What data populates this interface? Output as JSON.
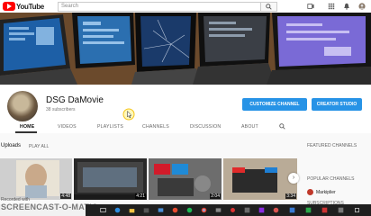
{
  "topbar": {
    "logo_text": "YouTube",
    "search_placeholder": "Search",
    "icons": [
      "search-icon",
      "upload-icon",
      "apps-icon",
      "notifications-icon",
      "account-icon"
    ]
  },
  "channel": {
    "name": "DSG DaMovie",
    "subscribers": "38 subscribers",
    "customize_label": "CUSTOMIZE CHANNEL",
    "studio_label": "CREATOR STUDIO"
  },
  "tabs": [
    {
      "label": "HOME",
      "active": true
    },
    {
      "label": "VIDEOS",
      "active": false
    },
    {
      "label": "PLAYLISTS",
      "active": false
    },
    {
      "label": "CHANNELS",
      "active": false
    },
    {
      "label": "DISCUSSION",
      "active": false
    },
    {
      "label": "ABOUT",
      "active": false
    }
  ],
  "uploads": {
    "title": "Uploads",
    "play_all": "PLAY ALL",
    "videos": [
      {
        "duration": "4:48"
      },
      {
        "duration": "4:21"
      },
      {
        "duration": "2:04"
      },
      {
        "duration": "3:34"
      }
    ]
  },
  "sidebar": {
    "featured_label": "FEATURED CHANNELS",
    "popular_label": "POPULAR CHANNELS",
    "popular": [
      {
        "name": "Markiplier"
      }
    ],
    "subscriptions_label": "SUBSCRIPTIONS"
  },
  "watermark": {
    "recorded_with": "Recorded with",
    "brand": "SCREENCAST-O-MATIC"
  },
  "colors": {
    "brand_red": "#ff0000",
    "button_blue": "#2793e6",
    "taskbar": "#1f1f1f"
  }
}
